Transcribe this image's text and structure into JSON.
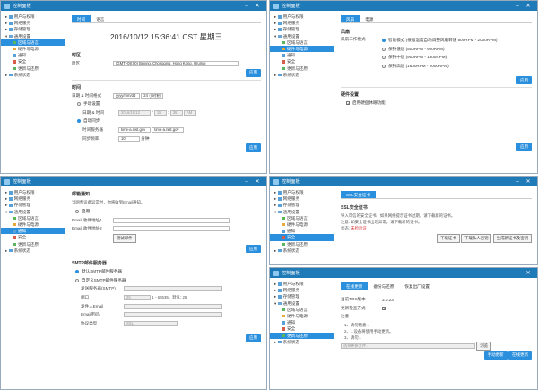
{
  "window_title": "控制面板",
  "ctrl": {
    "min": "–",
    "close": "✕"
  },
  "sidebar": {
    "users": "用户与权限",
    "network": "网络服务",
    "storage": "存储管理",
    "general": "通用设置",
    "region": "区域与语言",
    "hardware": "硬件与电源",
    "notify": "通知",
    "security": "安全",
    "update": "更新与还原",
    "status": "系统状态"
  },
  "w1": {
    "tab1": "时间",
    "tab2": "语言",
    "datetime": "2016/10/12  15:36:41 CST 星期三",
    "tz_head": "时区",
    "tz_label": "时区",
    "tz_value": "(GMT+08:00) Beijing, Chongqing, Hong Kong, Urumqi",
    "apply": "应用",
    "time_head": "时间",
    "fmt_label": "日期 & 时间格式",
    "fmt_date": "yyyy/mm/dd",
    "fmt_time": "24 小时制",
    "manual": "手动设置",
    "dt_label": "日期 & 时间",
    "date": "2016/10/12",
    "hh": "15",
    "mm": "36",
    "ampm": "AM",
    "auto": "自动同步",
    "server_label": "时间服务器",
    "server1": "time-a.nist.gov",
    "server2": "time-a.nist.gov",
    "freq_label": "同步频率",
    "freq": "10",
    "freq_unit": "分钟",
    "apply2": "应用"
  },
  "w2": {
    "tab1": "风扇",
    "tab2": "电源",
    "fan_head": "风扇",
    "fan_label": "风扇工作模式",
    "opt1": "智能模式 (根据温度自动调整风扇转速 500RPM - 2000RPM)",
    "opt2": "保持低速 (500RPM - 900RPM)",
    "opt3": "保持中速 (900RPM - 1600RPM)",
    "opt4": "保持高速 (1600RPM - 2000RPM)",
    "apply": "应用",
    "hw_head": "硬件设置",
    "hw_opt": "启用硬盘休眠功能",
    "apply2": "应用"
  },
  "w3": {
    "head": "邮箱通知",
    "desc": "当网判设备异常时，你将收到Email通知。",
    "enable": "启用",
    "addr1": "Email 收件地址1",
    "addr2": "Email 收件地址2",
    "test": "测试邮件",
    "apply": "应用",
    "smtp_head": "SMTP邮件服务器",
    "smtp1": "默认SMTP邮件服务器",
    "smtp2": "自定义SMTP邮件服务器",
    "server_label": "发送服务器(SMTP)",
    "port_label": "端口",
    "port": "25",
    "port_hint": "1 - 65535，默认: 25",
    "sender_label": "发件人Email",
    "pwd_label": "Email密码",
    "proto_label": "协议类型",
    "proto": "SSL",
    "apply2": "应用"
  },
  "w4": {
    "tab": "SSL安全证书",
    "head": "SSL安全证书",
    "desc1": "导入可信的安全证书。如果网络提示证书过期，请下载新的证书。",
    "desc2": "注意: 如安全证书出现异常，请下载新的证书。",
    "status_label": "状态:",
    "status": "未检验证",
    "b1": "下载证书",
    "b2": "下载私人密钥",
    "b3": "生成新证书及密钥"
  },
  "w5": {
    "tab1": "在线更新",
    "tab2": "备份与还原",
    "tab3": "恢复出厂设置",
    "ver_label": "当前TOS版本",
    "ver": "3.0.23",
    "auto_label": "更新检查方式",
    "note_label": "注意",
    "note1": "1、请勿随意...",
    "note2": "2、...设备将使用手动更新。",
    "note3": "3、请勿...",
    "file_hint": "选择更新文件...",
    "browse": "浏览",
    "manual": "手动更新",
    "online": "在线更新"
  }
}
